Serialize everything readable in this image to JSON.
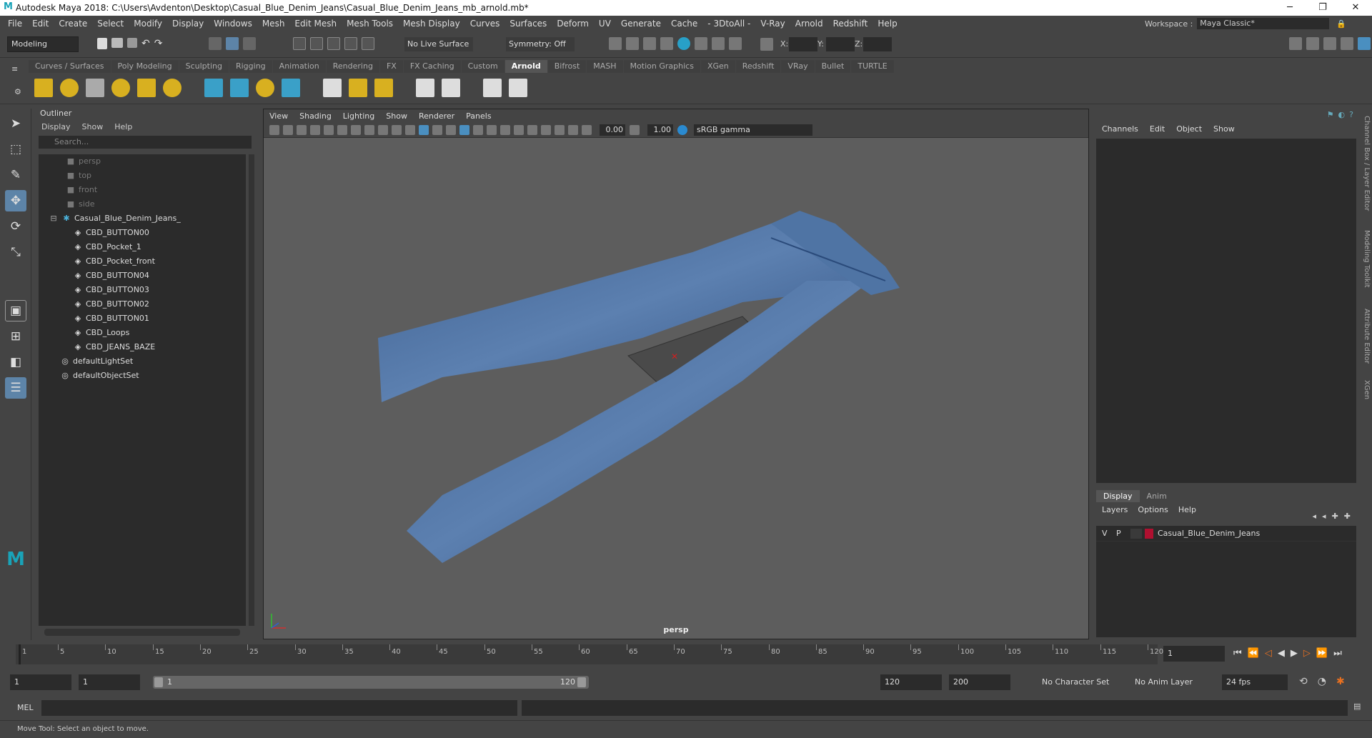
{
  "window": {
    "title": "Autodesk Maya 2018: C:\\Users\\Avdenton\\Desktop\\Casual_Blue_Denim_Jeans\\Casual_Blue_Denim_Jeans_mb_arnold.mb*"
  },
  "menubar": {
    "items": [
      "File",
      "Edit",
      "Create",
      "Select",
      "Modify",
      "Display",
      "Windows",
      "Mesh",
      "Edit Mesh",
      "Mesh Tools",
      "Mesh Display",
      "Curves",
      "Surfaces",
      "Deform",
      "UV",
      "Generate",
      "Cache",
      "- 3DtoAll -",
      "V-Ray",
      "Arnold",
      "Redshift",
      "Help"
    ],
    "workspace_label": "Workspace :",
    "workspace_value": "Maya Classic*"
  },
  "statusline": {
    "mode": "Modeling",
    "live_surface": "No Live Surface",
    "symmetry": "Symmetry: Off",
    "x_label": "X:",
    "y_label": "Y:",
    "z_label": "Z:"
  },
  "shelf": {
    "tabs": [
      "Curves / Surfaces",
      "Poly Modeling",
      "Sculpting",
      "Rigging",
      "Animation",
      "Rendering",
      "FX",
      "FX Caching",
      "Custom",
      "Arnold",
      "Bifrost",
      "MASH",
      "Motion Graphics",
      "XGen",
      "Redshift",
      "VRay",
      "Bullet",
      "TURTLE"
    ],
    "active_tab": "Arnold"
  },
  "outliner": {
    "title": "Outliner",
    "menu": [
      "Display",
      "Show",
      "Help"
    ],
    "search_placeholder": "Search...",
    "items": [
      {
        "label": "persp",
        "kind": "camera"
      },
      {
        "label": "top",
        "kind": "camera"
      },
      {
        "label": "front",
        "kind": "camera"
      },
      {
        "label": "side",
        "kind": "camera"
      },
      {
        "label": "Casual_Blue_Denim_Jeans_",
        "kind": "group"
      },
      {
        "label": "CBD_BUTTON00",
        "kind": "mesh"
      },
      {
        "label": "CBD_Pocket_1",
        "kind": "mesh"
      },
      {
        "label": "CBD_Pocket_front",
        "kind": "mesh"
      },
      {
        "label": "CBD_BUTTON04",
        "kind": "mesh"
      },
      {
        "label": "CBD_BUTTON03",
        "kind": "mesh"
      },
      {
        "label": "CBD_BUTTON02",
        "kind": "mesh"
      },
      {
        "label": "CBD_BUTTON01",
        "kind": "mesh"
      },
      {
        "label": "CBD_Loops",
        "kind": "mesh"
      },
      {
        "label": "CBD_JEANS_BAZE",
        "kind": "mesh"
      },
      {
        "label": "defaultLightSet",
        "kind": "set"
      },
      {
        "label": "defaultObjectSet",
        "kind": "set"
      }
    ]
  },
  "viewport": {
    "menu": [
      "View",
      "Shading",
      "Lighting",
      "Show",
      "Renderer",
      "Panels"
    ],
    "exposure": "0.00",
    "gamma": "1.00",
    "color_space": "sRGB gamma",
    "camera_label": "persp"
  },
  "channelbox": {
    "menu": [
      "Channels",
      "Edit",
      "Object",
      "Show"
    ],
    "layer_tabs": [
      "Display",
      "Anim"
    ],
    "layer_menu": [
      "Layers",
      "Options",
      "Help"
    ],
    "layer_row": {
      "v": "V",
      "p": "P",
      "name": "Casual_Blue_Denim_Jeans",
      "color": "#b01030"
    }
  },
  "side_tabs": [
    "Channel Box / Layer Editor",
    "Modeling Toolkit",
    "Attribute Editor",
    "XGen"
  ],
  "timeline": {
    "tick_labels": [
      "1",
      "5",
      "10",
      "15",
      "20",
      "25",
      "30",
      "35",
      "40",
      "45",
      "50",
      "55",
      "60",
      "65",
      "70",
      "75",
      "80",
      "85",
      "90",
      "95",
      "100",
      "105",
      "110",
      "115",
      "120"
    ],
    "current_frame": "1"
  },
  "range": {
    "start": "1",
    "playback_start": "1",
    "slider_start": "1",
    "slider_end": "120",
    "playback_end": "120",
    "end": "200",
    "character_set": "No Character Set",
    "anim_layer": "No Anim Layer",
    "fps": "24 fps"
  },
  "command": {
    "label": "MEL"
  },
  "helpline": "Move Tool: Select an object to move."
}
